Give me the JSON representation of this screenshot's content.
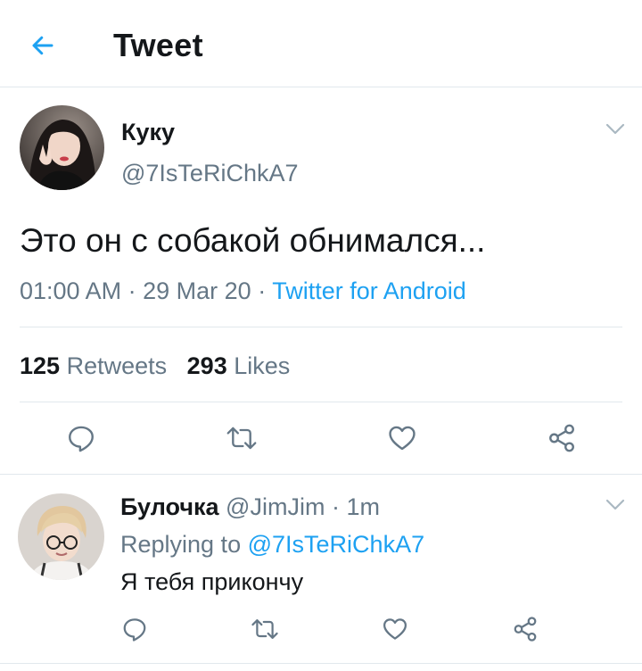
{
  "header": {
    "title": "Tweet"
  },
  "tweet": {
    "author": {
      "name": "Куку",
      "handle": "@7IsTeRiChkA7"
    },
    "text": "Это он с собакой обнимался...",
    "time": "01:00 AM",
    "date": "29 Mar 20",
    "separator": "·",
    "source": "Twitter for Android",
    "retweets": {
      "count": "125",
      "label": "Retweets"
    },
    "likes": {
      "count": "293",
      "label": "Likes"
    }
  },
  "reply": {
    "author": {
      "name": "Булочка",
      "handle": "@JimJim"
    },
    "separator": "·",
    "age": "1m",
    "replying_prefix": "Replying to",
    "replying_to": "@7IsTeRiChkA7",
    "text": "Я тебя прикончу"
  },
  "icons": {
    "back": "arrow-left-icon",
    "caret": "chevron-down-icon",
    "reply": "reply-icon",
    "retweet": "retweet-icon",
    "like": "heart-icon",
    "share": "share-icon"
  },
  "colors": {
    "accent": "#1da1f2",
    "text": "#14171a",
    "secondary": "#657786",
    "divider": "#e1e8ed",
    "icon": "#657786"
  }
}
